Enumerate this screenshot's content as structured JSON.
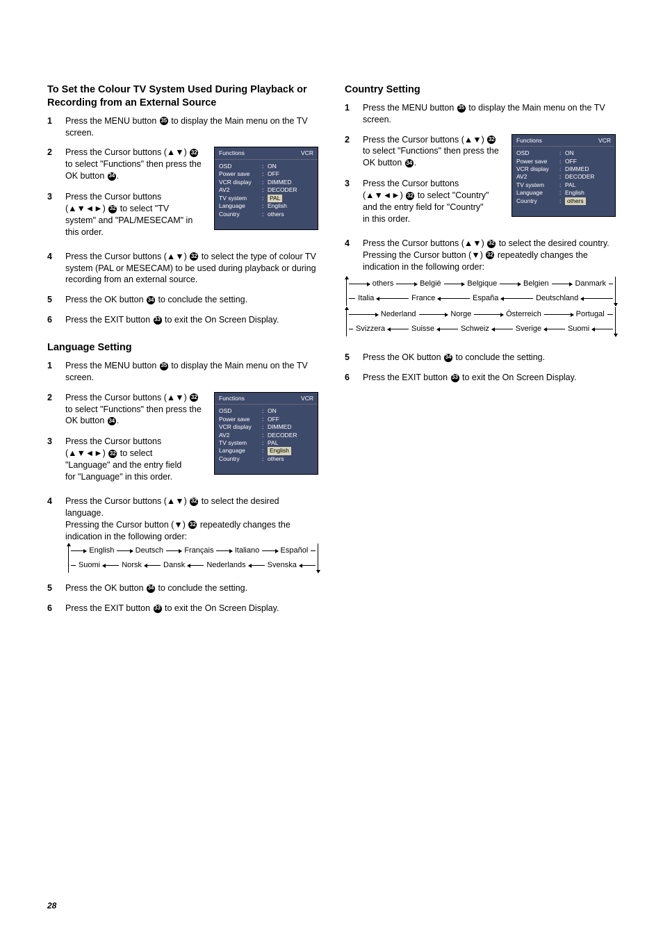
{
  "page_number": "28",
  "left": {
    "section1": {
      "heading": "To Set the Colour TV System Used During Playback or Recording from an External Source",
      "steps": {
        "s1": {
          "n": "1",
          "t_a": "Press the MENU button ",
          "ref": "35",
          "t_b": " to display the Main menu on the TV screen."
        },
        "s2": {
          "n": "2",
          "t_a": "Press the Cursor buttons (▲▼) ",
          "ref1": "32",
          "t_b": " to select \"Functions\" then press the OK button ",
          "ref2": "34",
          "t_c": "."
        },
        "s3": {
          "n": "3",
          "t_a": "Press the Cursor buttons (▲▼◄►) ",
          "ref": "32",
          "t_b": " to select \"TV system\" and \"PAL/MESECAM\" in this order."
        },
        "s4": {
          "n": "4",
          "t_a": "Press the Cursor buttons (▲▼) ",
          "ref": "32",
          "t_b": " to select the type of colour TV system (PAL or MESECAM) to be used during playback or during recording from an external source."
        },
        "s5": {
          "n": "5",
          "t_a": "Press the OK button ",
          "ref": "34",
          "t_b": " to conclude the setting."
        },
        "s6": {
          "n": "6",
          "t_a": "Press the EXIT button ",
          "ref": "33",
          "t_b": " to exit the On Screen Display."
        }
      },
      "osd": {
        "title": "Functions",
        "badge": "VCR",
        "rows": [
          {
            "l": "OSD",
            "v": "ON"
          },
          {
            "l": "Power save",
            "v": "OFF"
          },
          {
            "l": "VCR display",
            "v": "DIMMED"
          },
          {
            "l": "AV2",
            "v": "DECODER"
          },
          {
            "l": "TV system",
            "v": "PAL",
            "hl": true
          },
          {
            "l": "Language",
            "v": "English"
          },
          {
            "l": "Country",
            "v": "others"
          }
        ]
      }
    },
    "section2": {
      "heading": "Language Setting",
      "steps": {
        "s1": {
          "n": "1",
          "t_a": "Press the MENU button ",
          "ref": "35",
          "t_b": " to display the Main menu on the TV screen."
        },
        "s2": {
          "n": "2",
          "t_a": "Press the Cursor buttons (▲▼) ",
          "ref1": "32",
          "t_b": " to select \"Functions\" then press the OK button ",
          "ref2": "34",
          "t_c": "."
        },
        "s3": {
          "n": "3",
          "t_a": "Press the Cursor buttons (▲▼◄►) ",
          "ref": "32",
          "t_b": " to select \"Language\" and the entry field for \"Language\" in this order."
        },
        "s4": {
          "n": "4",
          "t_a": "Press the Cursor buttons (▲▼) ",
          "ref1": "32",
          "t_b": " to select the desired language.",
          "t_c": "Pressing the Cursor button (▼) ",
          "ref2": "32",
          "t_d": " repeatedly changes the indication in the following order:"
        },
        "s5": {
          "n": "5",
          "t_a": "Press the OK button ",
          "ref": "34",
          "t_b": " to conclude the setting."
        },
        "s6": {
          "n": "6",
          "t_a": "Press the EXIT button ",
          "ref": "33",
          "t_b": " to exit the On Screen Display."
        }
      },
      "osd": {
        "title": "Functions",
        "badge": "VCR",
        "rows": [
          {
            "l": "OSD",
            "v": "ON"
          },
          {
            "l": "Power save",
            "v": "OFF"
          },
          {
            "l": "VCR display",
            "v": "DIMMED"
          },
          {
            "l": "AV2",
            "v": "DECODER"
          },
          {
            "l": "TV system",
            "v": "PAL"
          },
          {
            "l": "Language",
            "v": "English",
            "hl": true
          },
          {
            "l": "Country",
            "v": "others"
          }
        ]
      },
      "cycle_row1": [
        "English",
        "Deutsch",
        "Français",
        "Italiano",
        "Español"
      ],
      "cycle_row2": [
        "Suomi",
        "Norsk",
        "Dansk",
        "Nederlands",
        "Svenska"
      ]
    }
  },
  "right": {
    "section1": {
      "heading": "Country Setting",
      "steps": {
        "s1": {
          "n": "1",
          "t_a": "Press the MENU button ",
          "ref": "35",
          "t_b": " to display the Main menu on the TV screen."
        },
        "s2": {
          "n": "2",
          "t_a": "Press the Cursor buttons (▲▼) ",
          "ref1": "32",
          "t_b": " to select \"Functions\" then press the OK button ",
          "ref2": "34",
          "t_c": "."
        },
        "s3": {
          "n": "3",
          "t_a": "Press the Cursor buttons (▲▼◄►) ",
          "ref": "32",
          "t_b": " to select \"Country\" and the entry field for \"Country\" in this order."
        },
        "s4": {
          "n": "4",
          "t_a": "Press the Cursor buttons (▲▼) ",
          "ref1": "32",
          "t_b": " to select the desired country.",
          "t_c": "Pressing the Cursor button (▼) ",
          "ref2": "32",
          "t_d": " repeatedly changes the indication in the following order:"
        },
        "s5": {
          "n": "5",
          "t_a": "Press the OK button ",
          "ref": "34",
          "t_b": " to conclude the setting."
        },
        "s6": {
          "n": "6",
          "t_a": "Press the EXIT button ",
          "ref": "33",
          "t_b": " to exit the On Screen Display."
        }
      },
      "osd": {
        "title": "Functions",
        "badge": "VCR",
        "rows": [
          {
            "l": "OSD",
            "v": "ON"
          },
          {
            "l": "Power save",
            "v": "OFF"
          },
          {
            "l": "VCR display",
            "v": "DIMMED"
          },
          {
            "l": "AV2",
            "v": "DECODER"
          },
          {
            "l": "TV system",
            "v": "PAL"
          },
          {
            "l": "Language",
            "v": "English"
          },
          {
            "l": "Country",
            "v": "others",
            "hl": true
          }
        ]
      },
      "cycle_r1": [
        "others",
        "België",
        "Belgique",
        "Belgien",
        "Danmark"
      ],
      "cycle_r2": [
        "Italia",
        "France",
        "España",
        "Deutschland"
      ],
      "cycle_r3": [
        "Nederland",
        "Norge",
        "Österreich",
        "Portugal"
      ],
      "cycle_r4": [
        "Svizzera",
        "Suisse",
        "Schweiz",
        "Sverige",
        "Suomi"
      ]
    }
  }
}
